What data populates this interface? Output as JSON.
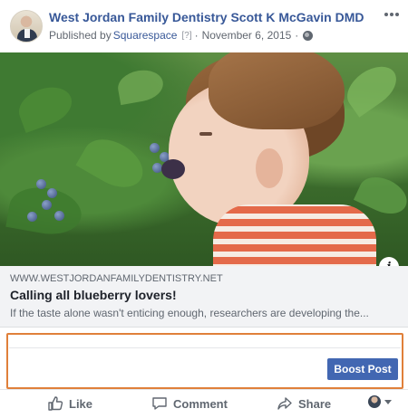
{
  "post": {
    "page_name": "West Jordan Family Dentistry Scott K McGavin DMD",
    "published_by_prefix": "Published by",
    "publisher": "Squarespace",
    "publisher_help": "[?]",
    "separator": "·",
    "date": "November 6, 2015",
    "separator2": "·"
  },
  "link_preview": {
    "domain": "WWW.WESTJORDANFAMILYDENTISTRY.NET",
    "title": "Calling all blueberry lovers!",
    "description": "If the taste alone wasn't enticing enough, researchers are developing the..."
  },
  "boost": {
    "button_label": "Boost Post",
    "highlight_color": "#e0803a",
    "button_color": "#4267b2"
  },
  "actions": {
    "like_label": "Like",
    "comment_label": "Comment",
    "share_label": "Share"
  },
  "icons": {
    "more": "more-horizontal-icon",
    "privacy": "globe-icon",
    "info": "info-icon",
    "like": "thumbs-up-icon",
    "comment": "speech-bubble-icon",
    "share": "share-arrow-icon",
    "audience": "audience-selector-icon"
  }
}
